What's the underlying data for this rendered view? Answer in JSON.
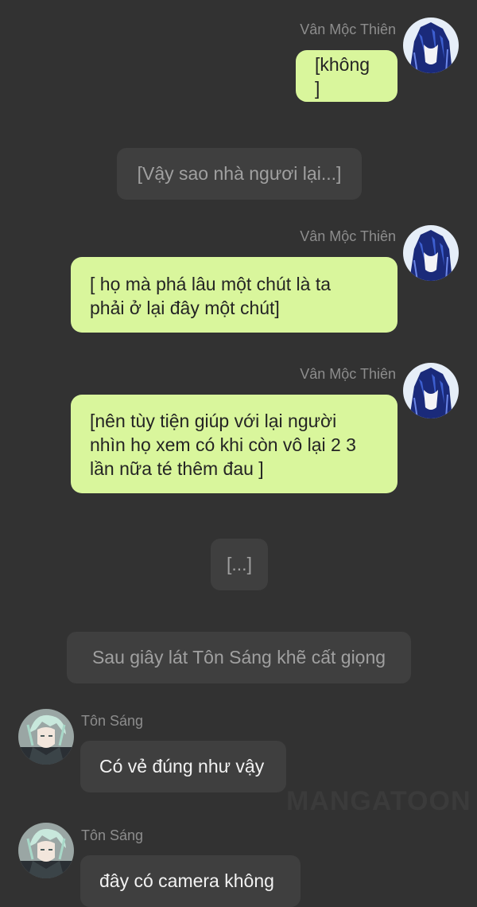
{
  "messages": [
    {
      "speaker": "Vân Mộc Thiên",
      "text": "[không ]"
    },
    {
      "narration": "[Vậy sao nhà ngươi lại...]"
    },
    {
      "speaker": "Vân Mộc Thiên",
      "lines": [
        "[ họ mà phá lâu một chút là ta",
        "phải ở lại đây một chút]"
      ]
    },
    {
      "speaker": "Vân Mộc Thiên",
      "lines": [
        "[nên tùy tiện giúp với lại người",
        "nhìn họ xem có khi còn vô lại 2 3",
        "lần nữa té thêm đau ]"
      ]
    },
    {
      "narration": "[...]"
    },
    {
      "narration": "Sau giây lát Tôn Sáng khẽ cất giọng"
    },
    {
      "speaker": "Tôn Sáng",
      "text": "Có vẻ đúng như vậy"
    },
    {
      "speaker": "Tôn Sáng",
      "text": "đây có camera không"
    }
  ],
  "watermark": "MANGATOON",
  "colors": {
    "background": "#323232",
    "my_bubble": "#d9f69c",
    "other_bubble": "#3f3f3f",
    "name_text": "#8d8d8d"
  },
  "icons": {
    "van_moc_thien_avatar": "avatar-dark-blue-hair",
    "ton_sang_avatar": "avatar-green-hair"
  }
}
